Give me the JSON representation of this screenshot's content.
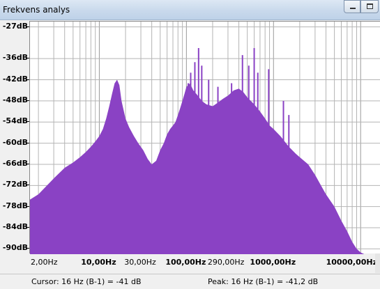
{
  "window": {
    "title": "Frekvens analys"
  },
  "chart_data": {
    "type": "area",
    "xscale": "log",
    "xlim": [
      1.6,
      17000
    ],
    "ylim": [
      -91.5,
      -25.5
    ],
    "grid": true,
    "fill_color": "#8a42c4",
    "y_ticks": [
      {
        "v": -27,
        "label": "-27dB"
      },
      {
        "v": -36,
        "label": "-36dB"
      },
      {
        "v": -42,
        "label": "-42dB"
      },
      {
        "v": -48,
        "label": "-48dB"
      },
      {
        "v": -54,
        "label": "-54dB"
      },
      {
        "v": -60,
        "label": "-60dB"
      },
      {
        "v": -66,
        "label": "-66dB"
      },
      {
        "v": -72,
        "label": "-72dB"
      },
      {
        "v": -78,
        "label": "-78dB"
      },
      {
        "v": -84,
        "label": "-84dB"
      },
      {
        "v": -90,
        "label": "-90dB"
      }
    ],
    "x_ticks": [
      {
        "v": 2,
        "label": "2,00Hz",
        "bold": false
      },
      {
        "v": 10,
        "label": "10,00Hz",
        "bold": true
      },
      {
        "v": 30,
        "label": "30,00Hz",
        "bold": false
      },
      {
        "v": 100,
        "label": "100,00Hz",
        "bold": true
      },
      {
        "v": 290,
        "label": "290,00Hz",
        "bold": false
      },
      {
        "v": 1000,
        "label": "1000,00Hz",
        "bold": true
      },
      {
        "v": 10000,
        "label": "10000,00Hz",
        "bold": true
      }
    ],
    "x": [
      1.6,
      2,
      3,
      4,
      5,
      6,
      7,
      8,
      9,
      10,
      11,
      12,
      13,
      14,
      15,
      16,
      17,
      18,
      20,
      22,
      25,
      28,
      32,
      36,
      40,
      45,
      50,
      55,
      60,
      65,
      70,
      75,
      80,
      85,
      90,
      95,
      100,
      110,
      120,
      130,
      150,
      170,
      200,
      230,
      260,
      300,
      350,
      400,
      450,
      500,
      600,
      700,
      800,
      900,
      1000,
      1200,
      1500,
      1800,
      2000,
      2500,
      3000,
      3500,
      4000,
      5000,
      6000,
      7000,
      8000,
      9000,
      10000,
      11000
    ],
    "y": [
      -76,
      -74.5,
      -70,
      -67,
      -65.5,
      -64,
      -62.5,
      -61,
      -59.5,
      -58,
      -56,
      -53,
      -49.5,
      -46,
      -43,
      -42,
      -43.5,
      -48,
      -53,
      -55.5,
      -58,
      -60,
      -62,
      -64.5,
      -66,
      -65,
      -62,
      -60,
      -57.5,
      -56,
      -55,
      -54,
      -52,
      -50,
      -48,
      -46,
      -44,
      -43,
      -45,
      -46,
      -48,
      -49,
      -49.5,
      -48.5,
      -47.5,
      -46.5,
      -45,
      -44.5,
      -45.5,
      -47,
      -49,
      -51,
      -53,
      -55,
      -56,
      -58,
      -61,
      -63,
      -64,
      -66,
      -69,
      -72,
      -74.5,
      -78,
      -82,
      -85,
      -88,
      -90,
      -91,
      -91.5
    ],
    "peaks": [
      {
        "x": 70,
        "y": -56
      },
      {
        "x": 105,
        "y": -43
      },
      {
        "x": 112,
        "y": -40
      },
      {
        "x": 125,
        "y": -37
      },
      {
        "x": 138,
        "y": -33
      },
      {
        "x": 150,
        "y": -38
      },
      {
        "x": 180,
        "y": -42
      },
      {
        "x": 230,
        "y": -44
      },
      {
        "x": 330,
        "y": -43
      },
      {
        "x": 440,
        "y": -35
      },
      {
        "x": 520,
        "y": -38
      },
      {
        "x": 600,
        "y": -33
      },
      {
        "x": 660,
        "y": -40
      },
      {
        "x": 880,
        "y": -39
      },
      {
        "x": 1300,
        "y": -48
      },
      {
        "x": 1500,
        "y": -52
      }
    ]
  },
  "status": {
    "cursor": "Cursor: 16 Hz (B-1) = -41 dB",
    "peak": "Peak: 16 Hz (B-1) = -41,2 dB"
  }
}
